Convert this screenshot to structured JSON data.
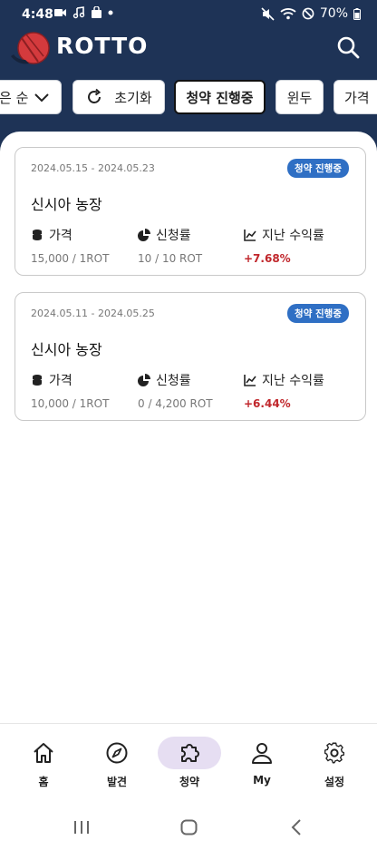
{
  "status_bar": {
    "time": "4:48",
    "battery": "70%"
  },
  "app": {
    "brand": "ROTTO"
  },
  "filters": [
    {
      "label": "은 순"
    },
    {
      "label": "초기화"
    },
    {
      "label": "청약 진행중"
    },
    {
      "label": "윈두"
    },
    {
      "label": "가격"
    }
  ],
  "cards": [
    {
      "date_range": "2024.05.15 - 2024.05.23",
      "badge": "청약 진행중",
      "title": "신시아 농장",
      "price_label": "가격",
      "price_value": "15,000 / 1ROT",
      "rate_label": "신청률",
      "rate_value": "10 / 10 ROT",
      "return_label": "지난 수익률",
      "return_value": "+7.68%"
    },
    {
      "date_range": "2024.05.11 - 2024.05.25",
      "badge": "청약 진행중",
      "title": "신시아 농장",
      "price_label": "가격",
      "price_value": "10,000 / 1ROT",
      "rate_label": "신청률",
      "rate_value": "0 / 4,200 ROT",
      "return_label": "지난 수익률",
      "return_value": "+6.44%"
    }
  ],
  "bottom_nav": [
    {
      "label": "홈",
      "icon": "home-icon"
    },
    {
      "label": "발견",
      "icon": "compass-icon"
    },
    {
      "label": "청약",
      "icon": "puzzle-icon"
    },
    {
      "label": "My",
      "icon": "person-icon"
    },
    {
      "label": "설정",
      "icon": "gear-icon"
    }
  ],
  "colors": {
    "header_bg": "#1e3356",
    "badge_bg": "#2f6fc4",
    "return_red": "#c0262b",
    "active_nav_bg": "#e6def2"
  }
}
